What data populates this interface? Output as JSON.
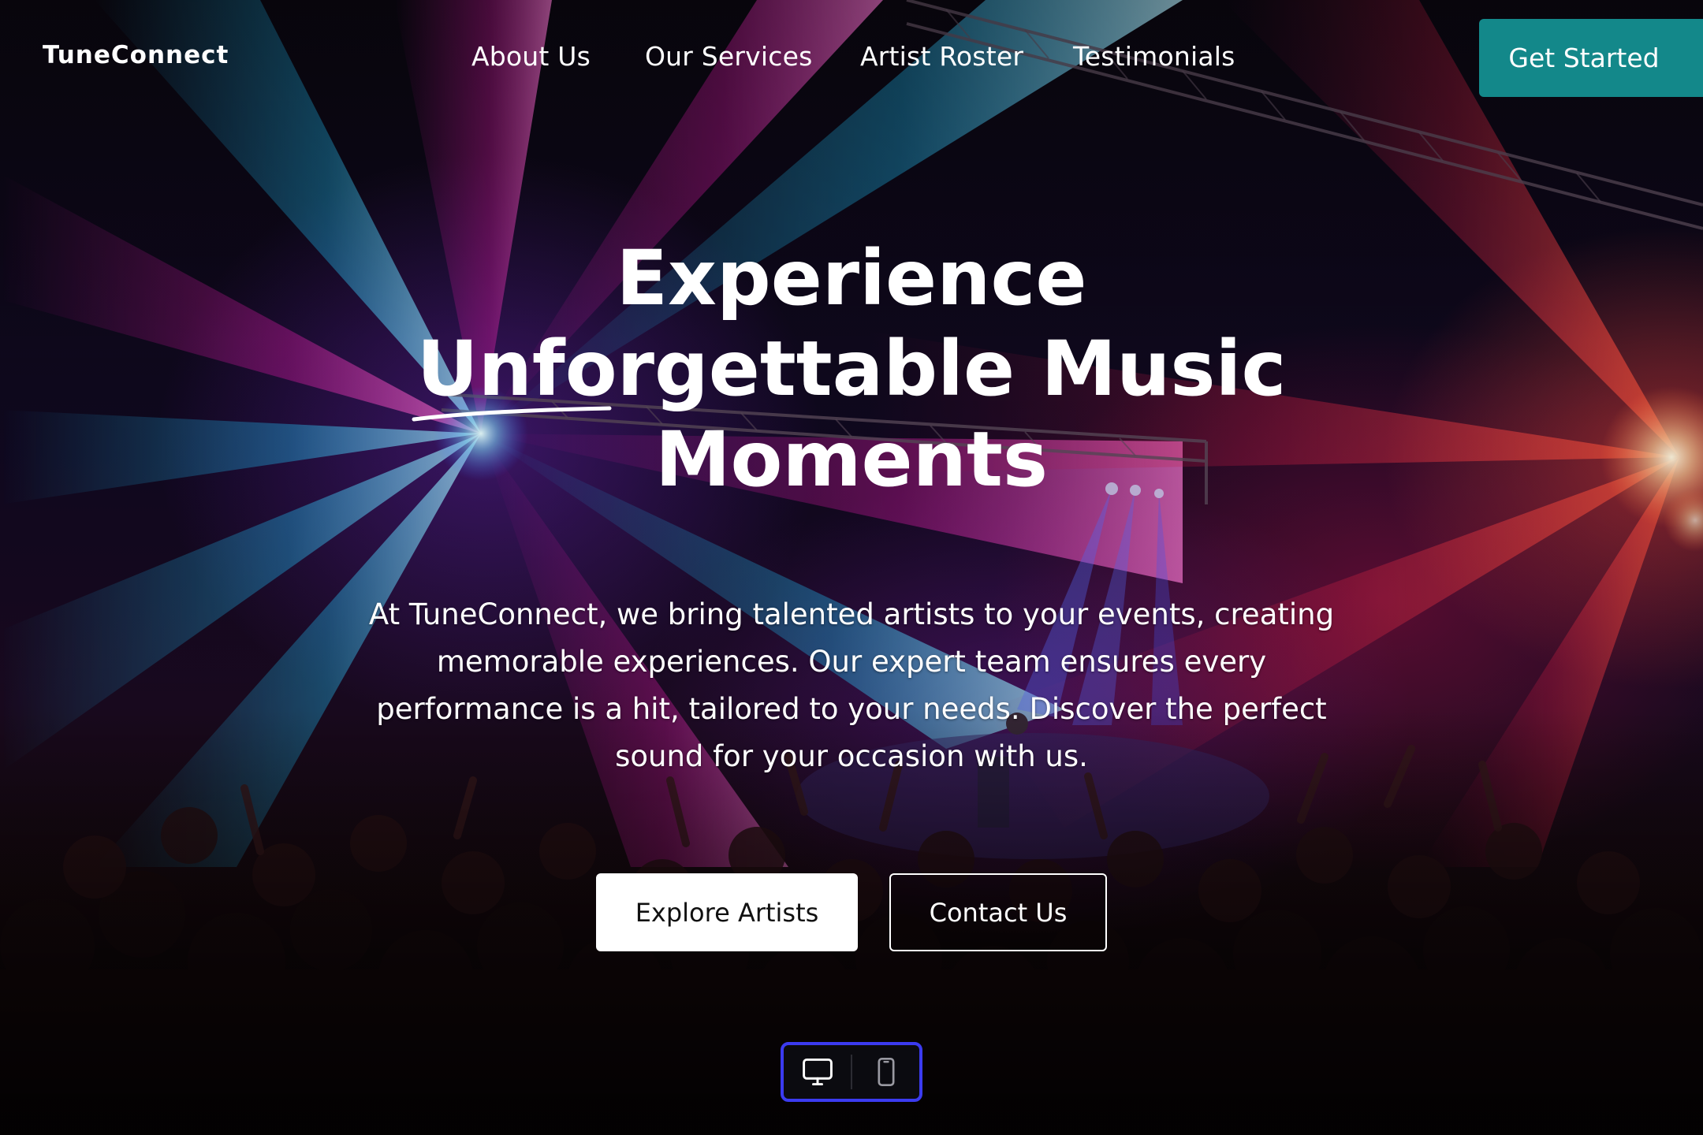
{
  "brand": {
    "name": "TuneConnect"
  },
  "nav": {
    "items": [
      {
        "label": "About Us"
      },
      {
        "label": "Our Services"
      },
      {
        "label": "Artist Roster"
      },
      {
        "label": "Testimonials"
      }
    ],
    "cta_label": "Get Started",
    "cta_color": "#13888a"
  },
  "hero": {
    "headline_line1": "Experience",
    "headline_line2_underlined": "Unfor",
    "headline_line2_rest": "gettable Music",
    "headline_line3": "Moments",
    "description": "At TuneConnect, we bring talented artists to your events, creating memorable experiences. Our expert team ensures every performance is a hit, tailored to your needs. Discover the perfect sound for your occasion with us.",
    "primary_button": "Explore Artists",
    "secondary_button": "Contact Us",
    "background": "concert-crowd-stage-lights-image"
  },
  "device_toggle": {
    "options": [
      {
        "icon": "desktop-icon"
      },
      {
        "icon": "mobile-icon"
      }
    ],
    "border_color": "#3b3bf0"
  }
}
